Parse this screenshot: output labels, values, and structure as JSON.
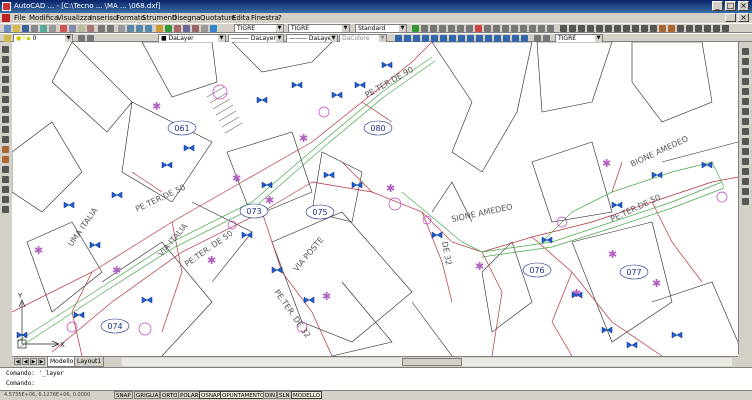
{
  "window": {
    "title": "AutoCAD ...  - [C:\\Tecno ... \\MA ... \\068.dxf]"
  },
  "menu": [
    "File",
    "Modifica",
    "Visualizza",
    "Inserisci",
    "Formato",
    "Strumenti",
    "Disegna",
    "Quotature",
    "Edita",
    "Finestra",
    "?"
  ],
  "toolbar": {
    "style_combo": "TIGRE",
    "text_style_combo": "TIGRE",
    "dim_style_combo": "Standard",
    "layer_combo": "0",
    "color_combo": "DaLayer",
    "linetype_combo": "DaLayer",
    "lineweight_combo": "DaLayer",
    "plotstyle_combo": "DaColore",
    "view_combo": "TIGRE"
  },
  "drawing": {
    "block_labels": [
      "061",
      "080",
      "075",
      "073",
      "074",
      "076",
      "077"
    ],
    "street_labels": [
      "PE.TER.DE 90",
      "PE.TER.DE 50",
      "PE.TER. DE 50",
      "PE.TER. DE 32",
      "VIA POSTE",
      "DE 32",
      "VIA ITALIA",
      "UMA ITALIA",
      "SIONE AMEDEO",
      "BIONE AMEDEO",
      "PE.TER.DE 50"
    ]
  },
  "layout_tabs": [
    "Modello",
    "Layout1"
  ],
  "command": {
    "line1": "Comando: '_layer",
    "line2": "Comando:"
  },
  "status": {
    "coords": "  4.5735E+06,  6.1276E+06,  0.0000",
    "buttons": [
      {
        "label": "SNAP",
        "on": false
      },
      {
        "label": "GRIGLIA",
        "on": false
      },
      {
        "label": "ORTO",
        "on": false
      },
      {
        "label": "POLARE",
        "on": false
      },
      {
        "label": "OSNAP",
        "on": true
      },
      {
        "label": "OPUNTAMENTO",
        "on": true
      },
      {
        "label": "DIN",
        "on": false
      },
      {
        "label": "SLN",
        "on": false
      },
      {
        "label": "MODELLO",
        "on": true
      }
    ]
  }
}
